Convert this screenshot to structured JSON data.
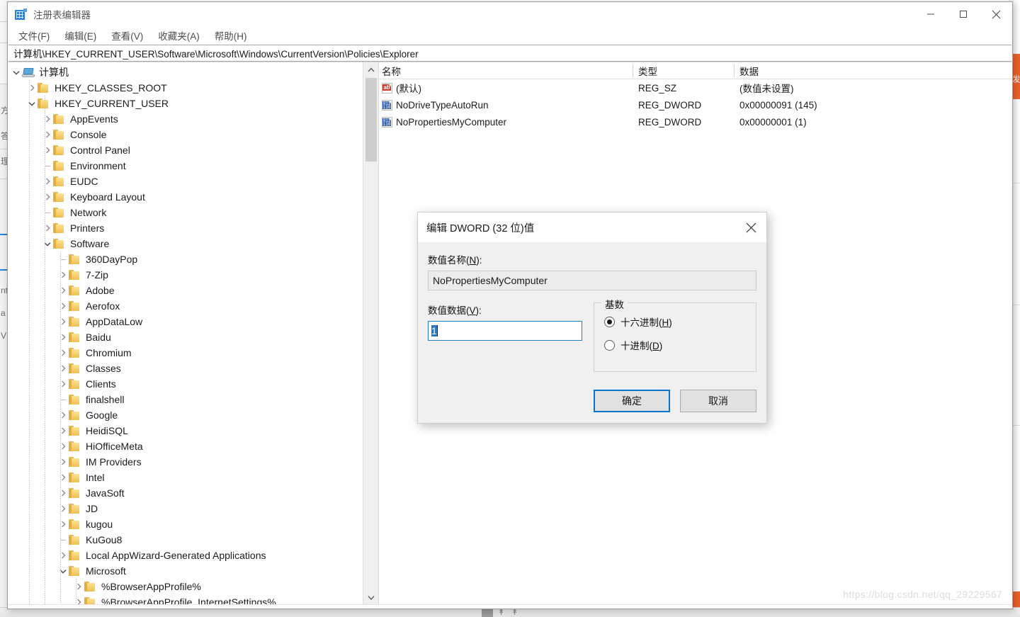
{
  "window": {
    "title": "注册表编辑器",
    "icon": "registry-editor-icon",
    "minimize_label": "最小化",
    "maximize_label": "最大化",
    "close_label": "关闭"
  },
  "menubar": {
    "items": [
      {
        "label": "文件(F)"
      },
      {
        "label": "编辑(E)"
      },
      {
        "label": "查看(V)"
      },
      {
        "label": "收藏夹(A)"
      },
      {
        "label": "帮助(H)"
      }
    ]
  },
  "address": {
    "path": "计算机\\HKEY_CURRENT_USER\\Software\\Microsoft\\Windows\\CurrentVersion\\Policies\\Explorer"
  },
  "tree": {
    "nodes": [
      {
        "label": "计算机",
        "depth": 0,
        "state": "expanded",
        "icon": "computer-icon"
      },
      {
        "label": "HKEY_CLASSES_ROOT",
        "depth": 1,
        "state": "collapsed",
        "icon": "folder-icon"
      },
      {
        "label": "HKEY_CURRENT_USER",
        "depth": 1,
        "state": "expanded",
        "icon": "folder-icon"
      },
      {
        "label": "AppEvents",
        "depth": 2,
        "state": "collapsed",
        "icon": "folder-icon"
      },
      {
        "label": "Console",
        "depth": 2,
        "state": "collapsed",
        "icon": "folder-icon"
      },
      {
        "label": "Control Panel",
        "depth": 2,
        "state": "collapsed",
        "icon": "folder-icon"
      },
      {
        "label": "Environment",
        "depth": 2,
        "state": "leaf",
        "icon": "folder-icon"
      },
      {
        "label": "EUDC",
        "depth": 2,
        "state": "collapsed",
        "icon": "folder-icon"
      },
      {
        "label": "Keyboard Layout",
        "depth": 2,
        "state": "collapsed",
        "icon": "folder-icon"
      },
      {
        "label": "Network",
        "depth": 2,
        "state": "leaf",
        "icon": "folder-icon"
      },
      {
        "label": "Printers",
        "depth": 2,
        "state": "collapsed",
        "icon": "folder-icon"
      },
      {
        "label": "Software",
        "depth": 2,
        "state": "expanded",
        "icon": "folder-icon"
      },
      {
        "label": "360DayPop",
        "depth": 3,
        "state": "leaf",
        "icon": "folder-icon"
      },
      {
        "label": "7-Zip",
        "depth": 3,
        "state": "collapsed",
        "icon": "folder-icon"
      },
      {
        "label": "Adobe",
        "depth": 3,
        "state": "collapsed",
        "icon": "folder-icon"
      },
      {
        "label": "Aerofox",
        "depth": 3,
        "state": "collapsed",
        "icon": "folder-icon"
      },
      {
        "label": "AppDataLow",
        "depth": 3,
        "state": "collapsed",
        "icon": "folder-icon"
      },
      {
        "label": "Baidu",
        "depth": 3,
        "state": "collapsed",
        "icon": "folder-icon"
      },
      {
        "label": "Chromium",
        "depth": 3,
        "state": "collapsed",
        "icon": "folder-icon"
      },
      {
        "label": "Classes",
        "depth": 3,
        "state": "collapsed",
        "icon": "folder-icon"
      },
      {
        "label": "Clients",
        "depth": 3,
        "state": "collapsed",
        "icon": "folder-icon"
      },
      {
        "label": "finalshell",
        "depth": 3,
        "state": "leaf",
        "icon": "folder-icon"
      },
      {
        "label": "Google",
        "depth": 3,
        "state": "collapsed",
        "icon": "folder-icon"
      },
      {
        "label": "HeidiSQL",
        "depth": 3,
        "state": "collapsed",
        "icon": "folder-icon"
      },
      {
        "label": "HiOfficeMeta",
        "depth": 3,
        "state": "collapsed",
        "icon": "folder-icon"
      },
      {
        "label": "IM Providers",
        "depth": 3,
        "state": "collapsed",
        "icon": "folder-icon"
      },
      {
        "label": "Intel",
        "depth": 3,
        "state": "collapsed",
        "icon": "folder-icon"
      },
      {
        "label": "JavaSoft",
        "depth": 3,
        "state": "collapsed",
        "icon": "folder-icon"
      },
      {
        "label": "JD",
        "depth": 3,
        "state": "collapsed",
        "icon": "folder-icon"
      },
      {
        "label": "kugou",
        "depth": 3,
        "state": "collapsed",
        "icon": "folder-icon"
      },
      {
        "label": "KuGou8",
        "depth": 3,
        "state": "leaf",
        "icon": "folder-icon"
      },
      {
        "label": "Local AppWizard-Generated Applications",
        "depth": 3,
        "state": "collapsed",
        "icon": "folder-icon"
      },
      {
        "label": "Microsoft",
        "depth": 3,
        "state": "expanded",
        "icon": "folder-icon"
      },
      {
        "label": "%BrowserAppProfile%",
        "depth": 4,
        "state": "collapsed",
        "icon": "folder-icon"
      },
      {
        "label": "%BrowserAppProfile_InternetSettings%",
        "depth": 4,
        "state": "collapsed",
        "icon": "folder-icon"
      }
    ]
  },
  "values_list": {
    "columns": [
      {
        "label": "名称"
      },
      {
        "label": "类型"
      },
      {
        "label": "数据"
      }
    ],
    "rows": [
      {
        "name": "(默认)",
        "type": "REG_SZ",
        "data": "(数值未设置)",
        "icon": "string-value-icon"
      },
      {
        "name": "NoDriveTypeAutoRun",
        "type": "REG_DWORD",
        "data": "0x00000091 (145)",
        "icon": "dword-value-icon"
      },
      {
        "name": "NoPropertiesMyComputer",
        "type": "REG_DWORD",
        "data": "0x00000001 (1)",
        "icon": "dword-value-icon"
      }
    ]
  },
  "dialog": {
    "title": "编辑 DWORD (32 位)值",
    "close_label": "关闭",
    "value_name_label_pre": "数值名称(",
    "value_name_label_key": "N",
    "value_name_label_post": "):",
    "value_name": "NoPropertiesMyComputer",
    "value_data_label_pre": "数值数据(",
    "value_data_label_key": "V",
    "value_data_label_post": "):",
    "value_data": "1",
    "base_group_title": "基数",
    "radios": [
      {
        "label_pre": "十六进制(",
        "label_key": "H",
        "label_post": ")",
        "selected": true
      },
      {
        "label_pre": "十进制(",
        "label_key": "D",
        "label_post": ")",
        "selected": false
      }
    ],
    "ok_label": "确定",
    "cancel_label": "取消"
  },
  "watermark": {
    "text": "https://blog.csdn.net/qq_29229567"
  },
  "background": {
    "orange_tab_text": "发",
    "left_window_fragments": [
      "方",
      "答",
      "理",
      "nt",
      "a",
      "V"
    ]
  },
  "colors": {
    "accent": "#0a74c8",
    "selection": "#2878c8",
    "folder": "#f0bf4f",
    "dword_icon": "#2f5fb0",
    "string_icon": "#cf3a27",
    "orange_tab": "#e8622c",
    "title_text": "#5a5a5a"
  }
}
